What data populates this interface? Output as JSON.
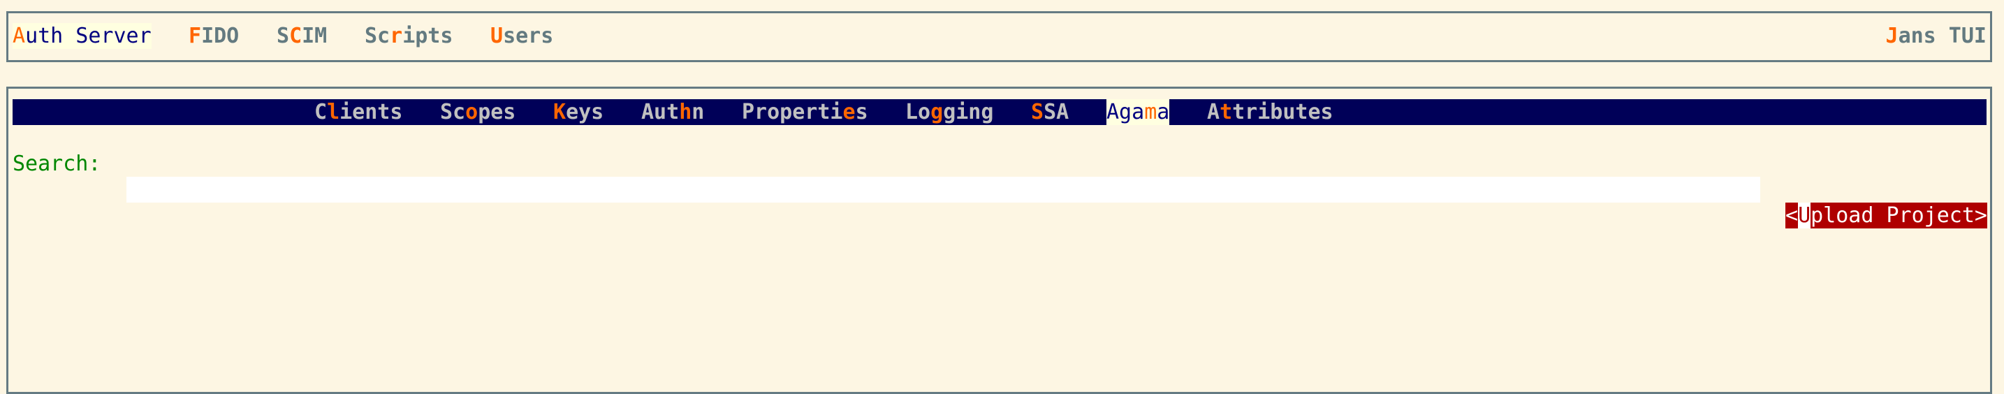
{
  "top_menu": {
    "items": [
      {
        "pre": "",
        "hk": "A",
        "post": "uth Server",
        "active": true
      },
      {
        "pre": "",
        "hk": "F",
        "post": "IDO"
      },
      {
        "pre": "S",
        "hk": "C",
        "post": "IM"
      },
      {
        "pre": "Sc",
        "hk": "r",
        "post": "ipts"
      },
      {
        "pre": "",
        "hk": "U",
        "post": "sers"
      }
    ],
    "app_title": {
      "pre": "",
      "hk": "J",
      "post": "ans TUI"
    }
  },
  "tabs": {
    "items": [
      {
        "pre": "C",
        "hk": "l",
        "post": "ients"
      },
      {
        "pre": "Sc",
        "hk": "o",
        "post": "pes"
      },
      {
        "pre": "",
        "hk": "K",
        "post": "eys"
      },
      {
        "pre": "Aut",
        "hk": "h",
        "post": "n"
      },
      {
        "pre": "Properti",
        "hk": "e",
        "post": "s"
      },
      {
        "pre": "Lo",
        "hk": "g",
        "post": "ging"
      },
      {
        "pre": "",
        "hk": "S",
        "post": "SA"
      },
      {
        "pre": "Aga",
        "hk": "m",
        "post": "a",
        "active": true
      },
      {
        "pre": "A",
        "hk": "t",
        "post": "tributes"
      }
    ]
  },
  "search": {
    "label": "Search:",
    "value": ""
  },
  "upload_button": {
    "open": "<",
    "hk": "U",
    "post": "pload Project>"
  },
  "colors": {
    "background": "#fdf6e3",
    "navbar": "#000058",
    "hotkey": "#ff6600",
    "button": "#af0000",
    "label": "#008700"
  }
}
